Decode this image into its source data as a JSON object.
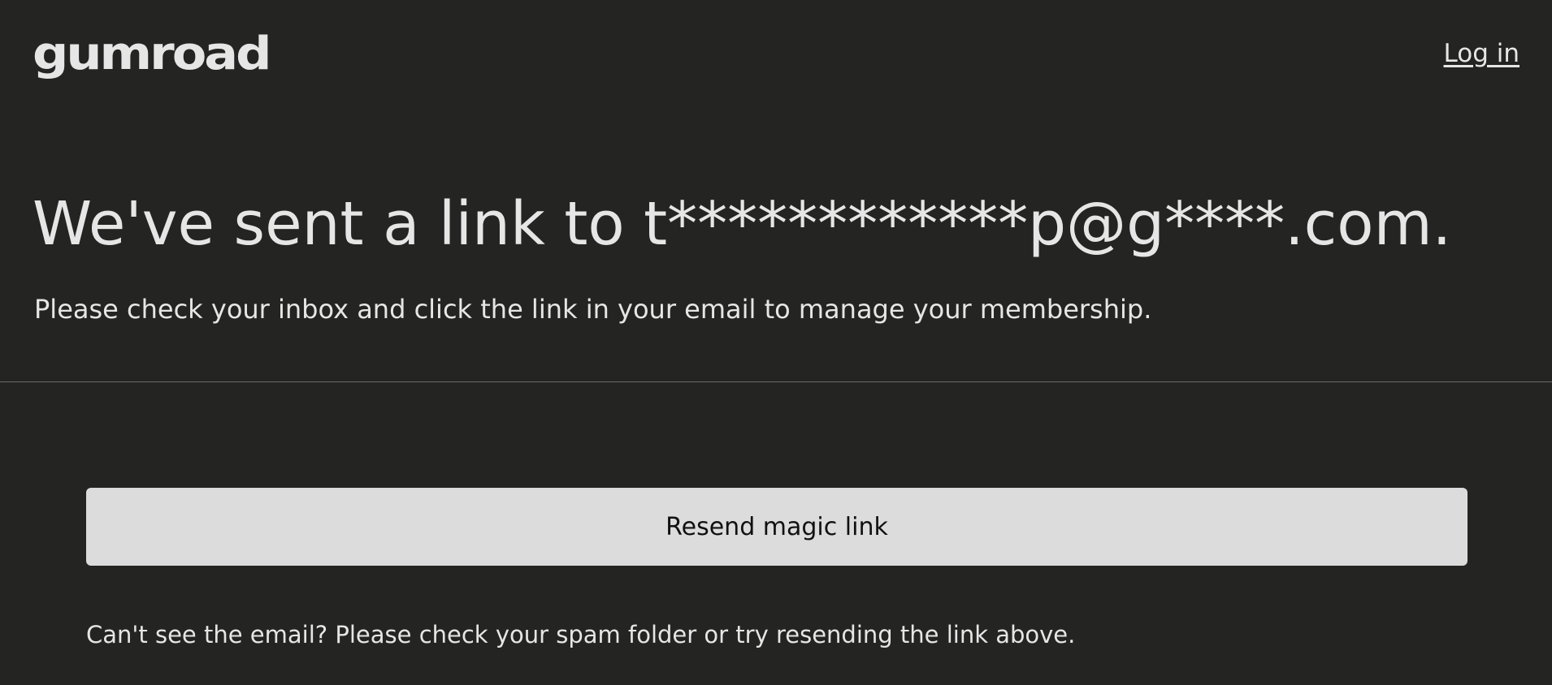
{
  "header": {
    "logo_text": "GUMroad",
    "login_label": "Log in"
  },
  "main": {
    "headline": "We've sent a link to t************p@g****.com.",
    "subtext": "Please check your inbox and click the link in your email to manage your membership."
  },
  "actions": {
    "resend_label": "Resend magic link"
  },
  "footer": {
    "help_text": "Can't see the email? Please check your spam folder or try resending the link above."
  },
  "colors": {
    "background": "#242423",
    "text": "#e6e6e6",
    "button_bg": "#dcdcdc",
    "button_text": "#111111",
    "divider": "#6b6b6a"
  }
}
